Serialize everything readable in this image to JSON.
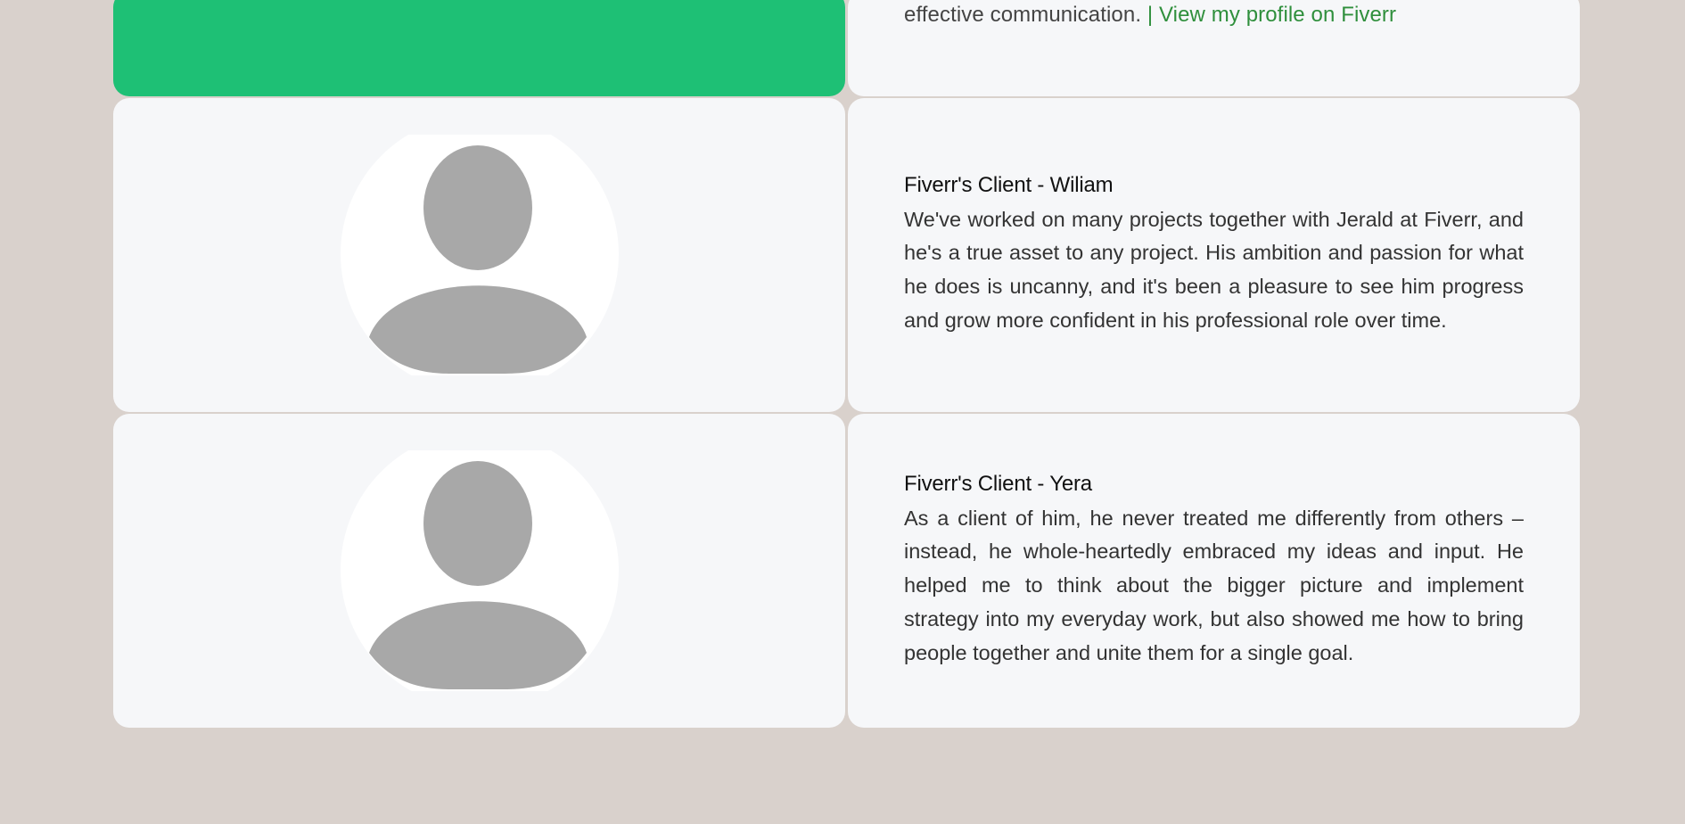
{
  "top": {
    "text": "effective communication.",
    "link_label": "| View my profile on Fiverr"
  },
  "testimonials": [
    {
      "name": "Fiverr's Client - Wiliam",
      "text": "We've worked on many projects together with Jerald at Fiverr, and he's a true asset to any project. His ambition and passion for what he does is uncanny, and it's been a pleasure to see him progress and grow more confident in his professional role over time.",
      "avatar_icon": "user-placeholder-icon"
    },
    {
      "name": "Fiverr's Client - Yera",
      "text": "As a client of him, he never treated me differently from others – instead, he whole-heartedly embraced my ideas and input. He helped me to think about the bigger picture and implement strategy into my everyday work, but also showed me how to bring people together and unite them for a single goal.",
      "avatar_icon": "user-placeholder-icon"
    }
  ],
  "colors": {
    "page_background": "#d9d1cc",
    "card_background": "#f6f7f9",
    "accent_green": "#1ec075",
    "link_green": "#2f8f3c",
    "avatar_gray": "#a8a8a8"
  }
}
